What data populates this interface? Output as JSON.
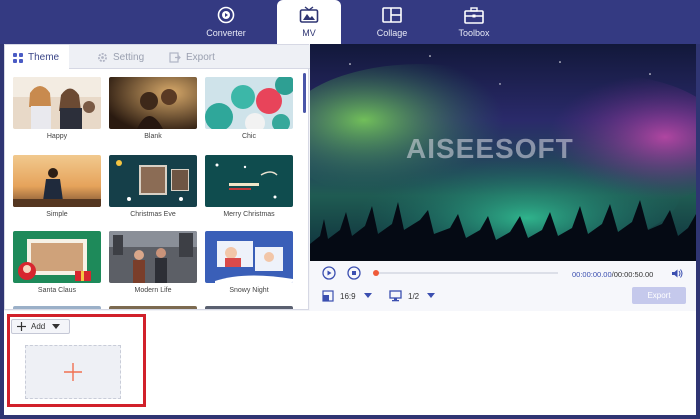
{
  "nav": {
    "items": [
      {
        "label": "Converter",
        "icon": "converter-icon"
      },
      {
        "label": "MV",
        "icon": "mv-icon"
      },
      {
        "label": "Collage",
        "icon": "collage-icon"
      },
      {
        "label": "Toolbox",
        "icon": "toolbox-icon"
      }
    ],
    "active": "MV"
  },
  "tabs": [
    {
      "label": "Theme",
      "active": true
    },
    {
      "label": "Setting",
      "active": false
    },
    {
      "label": "Export",
      "active": false
    }
  ],
  "themes": [
    "Happy",
    "Blank",
    "Chic",
    "Simple",
    "Christmas Eve",
    "Merry Christmas",
    "Santa Claus",
    "Modern Life",
    "Snowy Night"
  ],
  "preview": {
    "watermark": "AISEESOFT",
    "time_current": "00:00:00.00",
    "time_total": "/00:00:50.00",
    "aspect_ratio": "16:9",
    "screen_ratio": "1/2",
    "export_label": "Export"
  },
  "bottom": {
    "add_label": "Add"
  },
  "colors": {
    "nav_bg": "#343a82",
    "accent": "#3b4fb0",
    "highlight": "#d1202a",
    "plus": "#f07050"
  }
}
